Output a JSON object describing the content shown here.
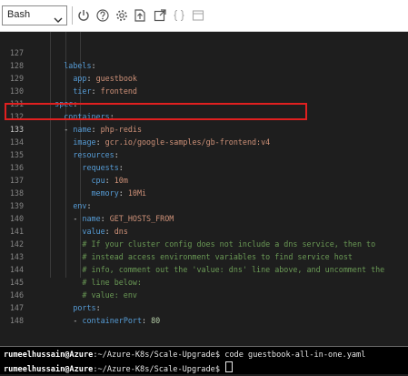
{
  "toolbar": {
    "shell": "Bash",
    "icons": [
      "chevron-down-icon",
      "power-icon",
      "help-icon",
      "settings-icon",
      "upload-download-icon",
      "open-new-session-icon",
      "braces-icon",
      "web-preview-icon"
    ]
  },
  "editor": {
    "lines": [
      {
        "num": "127",
        "text": "      labels:"
      },
      {
        "num": "128",
        "text": "        app: guestbook"
      },
      {
        "num": "129",
        "text": "        tier: frontend"
      },
      {
        "num": "130",
        "text": "    spec:"
      },
      {
        "num": "131",
        "text": "      containers:"
      },
      {
        "num": "132",
        "text": "      - name: php-redis"
      },
      {
        "num": "133",
        "text": "        image: gcr.io/google-samples/gb-frontend:v4"
      },
      {
        "num": "134",
        "text": "        resources:"
      },
      {
        "num": "135",
        "text": "          requests:"
      },
      {
        "num": "136",
        "text": "            cpu: 10m"
      },
      {
        "num": "137",
        "text": "            memory: 10Mi"
      },
      {
        "num": "138",
        "text": "        env:"
      },
      {
        "num": "139",
        "text": "        - name: GET_HOSTS_FROM"
      },
      {
        "num": "140",
        "text": "          value: dns"
      },
      {
        "num": "141",
        "text": "          # If your cluster config does not include a dns service, then to"
      },
      {
        "num": "142",
        "text": "          # instead access environment variables to find service host"
      },
      {
        "num": "143",
        "text": "          # info, comment out the 'value: dns' line above, and uncomment the"
      },
      {
        "num": "144",
        "text": "          # line below:"
      },
      {
        "num": "145",
        "text": "          # value: env"
      },
      {
        "num": "146",
        "text": "        ports:"
      },
      {
        "num": "147",
        "text": "        - containerPort: 80"
      },
      {
        "num": "148",
        "text": ""
      }
    ],
    "highlighted_line": "133"
  },
  "terminal": {
    "line1_user": "rumeelhussain@Azure",
    "line1_path": ":~/Azure-K8s/Scale-Upgrade",
    "line1_cmd": "$ code guestbook-all-in-one.yaml",
    "line2_user": "rumeelhussain@Azure",
    "line2_path": ":~/Azure-K8s/Scale-Upgrade",
    "line2_cmd": "$ "
  },
  "colors": {
    "editor_bg": "#1e1e1e",
    "yaml_key": "#569cd6",
    "yaml_string": "#ce9178",
    "yaml_number": "#b5cea8",
    "comment": "#6a9955",
    "highlight_box": "#e02020"
  }
}
